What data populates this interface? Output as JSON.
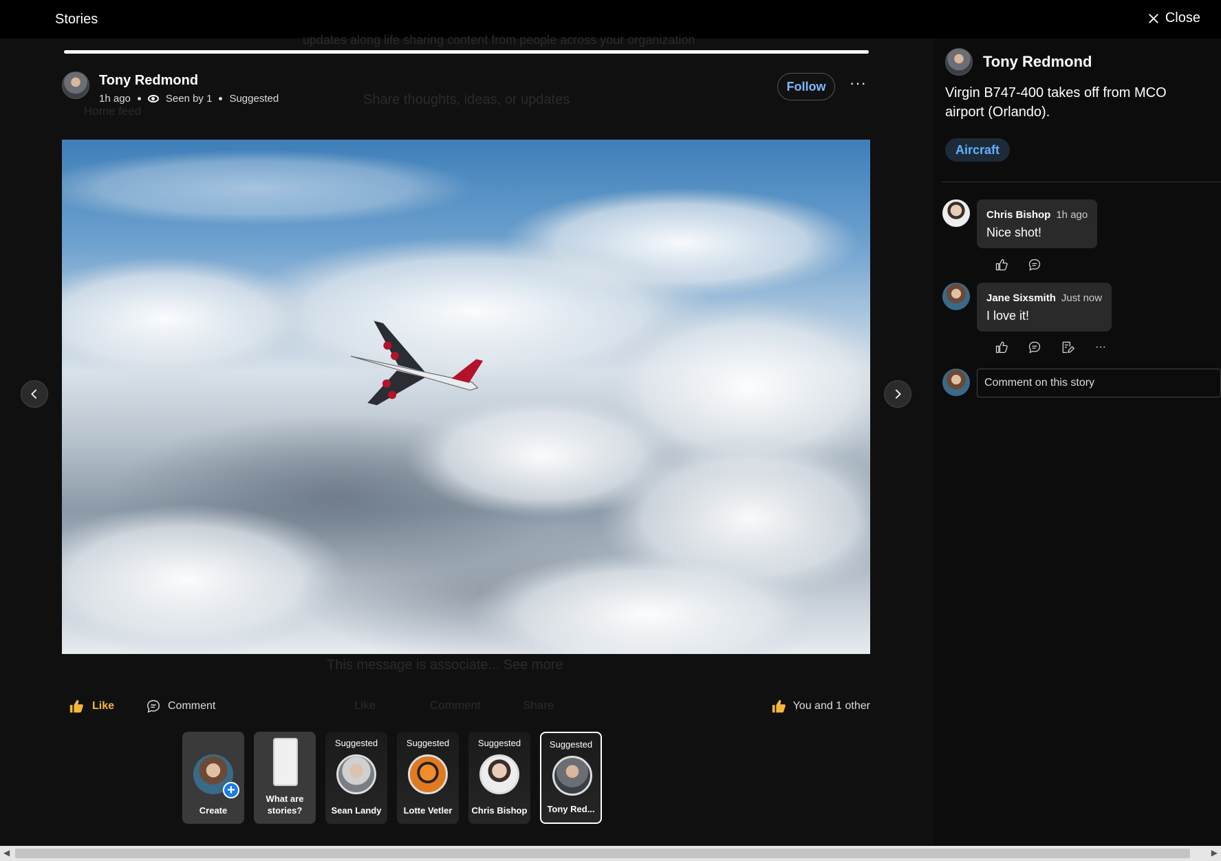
{
  "topbar": {
    "title": "Stories",
    "close_label": "Close"
  },
  "background_feed": {
    "line1": "updates along life sharing content from people across your organization",
    "composer_placeholder": "Share thoughts, ideas, or updates",
    "home_feed": "Home feed",
    "message": "This message is associate... See more",
    "like": "Like",
    "comment": "Comment",
    "share": "Share"
  },
  "story": {
    "author": "Tony Redmond",
    "time": "1h ago",
    "seen": "Seen by 1",
    "suggested": "Suggested",
    "follow_label": "Follow",
    "more_label": "···",
    "photo_icon": "airplane-in-clouds"
  },
  "actions": {
    "like_label": "Like",
    "comment_label": "Comment",
    "reactions_text": "You and 1 other"
  },
  "tray": [
    {
      "label": "Create",
      "kind": "create"
    },
    {
      "label": "What are stories?",
      "kind": "info"
    },
    {
      "label": "Sean Landy",
      "badge": "Suggested"
    },
    {
      "label": "Lotte Vetler",
      "badge": "Suggested"
    },
    {
      "label": "Chris Bishop",
      "badge": "Suggested"
    },
    {
      "label": "Tony Red...",
      "badge": "Suggested",
      "selected": true
    }
  ],
  "panel": {
    "author": "Tony Redmond",
    "caption": "Virgin B747-400 takes off from MCO airport (Orlando).",
    "tag": "Aircraft",
    "comments": [
      {
        "name": "Chris Bishop",
        "time": "1h ago",
        "text": "Nice shot!"
      },
      {
        "name": "Jane Sixsmith",
        "time": "Just now",
        "text": "I love it!"
      }
    ],
    "comment_placeholder": "Comment on this story"
  },
  "colors": {
    "accent": "#7cb8ff",
    "like": "#f5b73b",
    "tag": "#63b0ff"
  }
}
